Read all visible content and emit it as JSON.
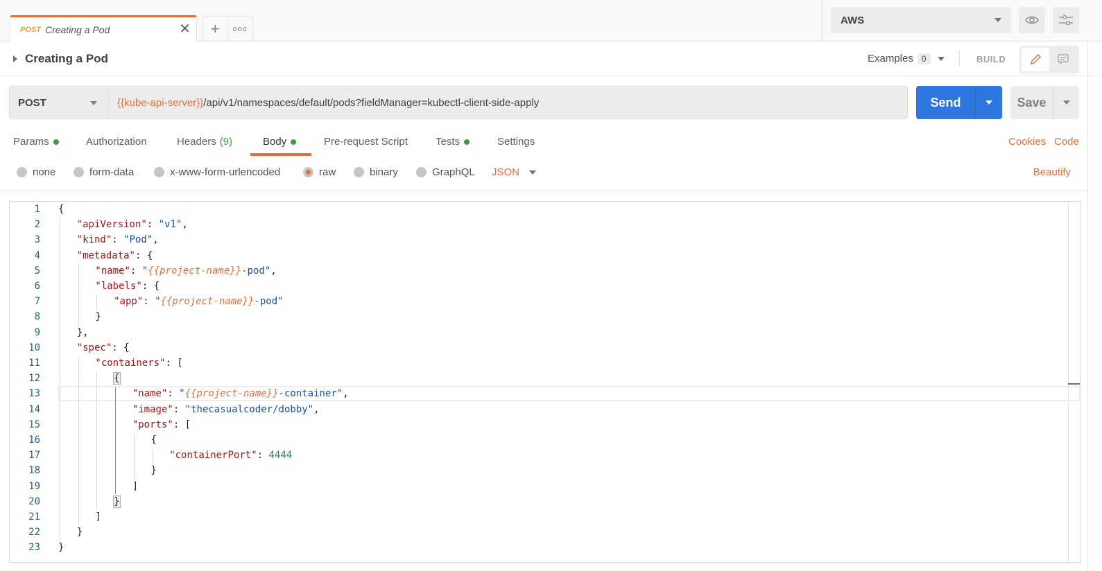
{
  "tabs": {
    "active": {
      "method": "POST",
      "name": "Creating a Pod"
    },
    "add_icon": "plus-icon",
    "more_icon": "more-horizontal-icon"
  },
  "environment": {
    "selected": "AWS",
    "quick_look_icon": "eye-icon",
    "manage_icon": "sliders-icon"
  },
  "request": {
    "title": "Creating a Pod",
    "examples_label": "Examples",
    "examples_count": "0",
    "build_label": "BUILD",
    "method": "POST",
    "url": {
      "variable": "{{kube-api-server}}",
      "path": "/api/v1/namespaces/default/pods?fieldManager=kubectl-client-side-apply"
    },
    "send_label": "Send",
    "save_label": "Save"
  },
  "request_tabs": [
    {
      "label": "Params",
      "dot": true
    },
    {
      "label": "Authorization"
    },
    {
      "label": "Headers",
      "count": "(9)"
    },
    {
      "label": "Body",
      "dot": true,
      "active": true
    },
    {
      "label": "Pre-request Script"
    },
    {
      "label": "Tests",
      "dot": true
    },
    {
      "label": "Settings"
    }
  ],
  "links": {
    "cookies": "Cookies",
    "code": "Code",
    "beautify": "Beautify"
  },
  "body_types": [
    {
      "label": "none"
    },
    {
      "label": "form-data"
    },
    {
      "label": "x-www-form-urlencoded"
    },
    {
      "label": "raw",
      "checked": true
    },
    {
      "label": "binary"
    },
    {
      "label": "GraphQL"
    }
  ],
  "body_format": "JSON",
  "colors": {
    "accent": "#e2703f",
    "send": "#2e77e0",
    "status_dot": "#3b9a4a",
    "method_tab": "#e6a12f"
  },
  "editor": {
    "lines": [
      {
        "n": "1",
        "indent": 0,
        "tokens": [
          [
            "p",
            "{"
          ]
        ]
      },
      {
        "n": "2",
        "indent": 1,
        "tokens": [
          [
            "k",
            "\"apiVersion\""
          ],
          [
            "p",
            ": "
          ],
          [
            "s",
            "\"v1\""
          ],
          [
            "p",
            ","
          ]
        ]
      },
      {
        "n": "3",
        "indent": 1,
        "tokens": [
          [
            "k",
            "\"kind\""
          ],
          [
            "p",
            ": "
          ],
          [
            "s",
            "\"Pod\""
          ],
          [
            "p",
            ","
          ]
        ]
      },
      {
        "n": "4",
        "indent": 1,
        "tokens": [
          [
            "k",
            "\"metadata\""
          ],
          [
            "p",
            ": {"
          ]
        ]
      },
      {
        "n": "5",
        "indent": 2,
        "tokens": [
          [
            "k",
            "\"name\""
          ],
          [
            "p",
            ": "
          ],
          [
            "s",
            "\""
          ],
          [
            "v",
            "{{project-name}}"
          ],
          [
            "s",
            "-pod\""
          ],
          [
            "p",
            ","
          ]
        ]
      },
      {
        "n": "6",
        "indent": 2,
        "tokens": [
          [
            "k",
            "\"labels\""
          ],
          [
            "p",
            ": {"
          ]
        ]
      },
      {
        "n": "7",
        "indent": 3,
        "tokens": [
          [
            "k",
            "\"app\""
          ],
          [
            "p",
            ": "
          ],
          [
            "s",
            "\""
          ],
          [
            "v",
            "{{project-name}}"
          ],
          [
            "s",
            "-pod\""
          ]
        ]
      },
      {
        "n": "8",
        "indent": 2,
        "tokens": [
          [
            "p",
            "}"
          ]
        ]
      },
      {
        "n": "9",
        "indent": 1,
        "tokens": [
          [
            "p",
            "},"
          ]
        ]
      },
      {
        "n": "10",
        "indent": 1,
        "tokens": [
          [
            "k",
            "\"spec\""
          ],
          [
            "p",
            ": {"
          ]
        ]
      },
      {
        "n": "11",
        "indent": 2,
        "tokens": [
          [
            "k",
            "\"containers\""
          ],
          [
            "p",
            ": ["
          ]
        ]
      },
      {
        "n": "12",
        "indent": 3,
        "tokens": [
          [
            "b",
            "{"
          ]
        ]
      },
      {
        "n": "13",
        "indent": 4,
        "tokens": [
          [
            "k",
            "\"name\""
          ],
          [
            "p",
            ": "
          ],
          [
            "s",
            "\""
          ],
          [
            "v",
            "{{project-name}}"
          ],
          [
            "s",
            "-container\""
          ],
          [
            "p",
            ","
          ]
        ],
        "current": true
      },
      {
        "n": "14",
        "indent": 4,
        "tokens": [
          [
            "k",
            "\"image\""
          ],
          [
            "p",
            ": "
          ],
          [
            "s",
            "\"thecasualcoder/dobby\""
          ],
          [
            "p",
            ","
          ]
        ]
      },
      {
        "n": "15",
        "indent": 4,
        "tokens": [
          [
            "k",
            "\"ports\""
          ],
          [
            "p",
            ": ["
          ]
        ]
      },
      {
        "n": "16",
        "indent": 5,
        "tokens": [
          [
            "p",
            "{"
          ]
        ]
      },
      {
        "n": "17",
        "indent": 6,
        "tokens": [
          [
            "k",
            "\"containerPort\""
          ],
          [
            "p",
            ": "
          ],
          [
            "n",
            "4444"
          ]
        ]
      },
      {
        "n": "18",
        "indent": 5,
        "tokens": [
          [
            "p",
            "}"
          ]
        ]
      },
      {
        "n": "19",
        "indent": 4,
        "tokens": [
          [
            "p",
            "]"
          ]
        ]
      },
      {
        "n": "20",
        "indent": 3,
        "tokens": [
          [
            "b",
            "}"
          ]
        ]
      },
      {
        "n": "21",
        "indent": 2,
        "tokens": [
          [
            "p",
            "]"
          ]
        ]
      },
      {
        "n": "22",
        "indent": 1,
        "tokens": [
          [
            "p",
            "}"
          ]
        ]
      },
      {
        "n": "23",
        "indent": 0,
        "tokens": [
          [
            "p",
            "}"
          ]
        ]
      }
    ]
  }
}
